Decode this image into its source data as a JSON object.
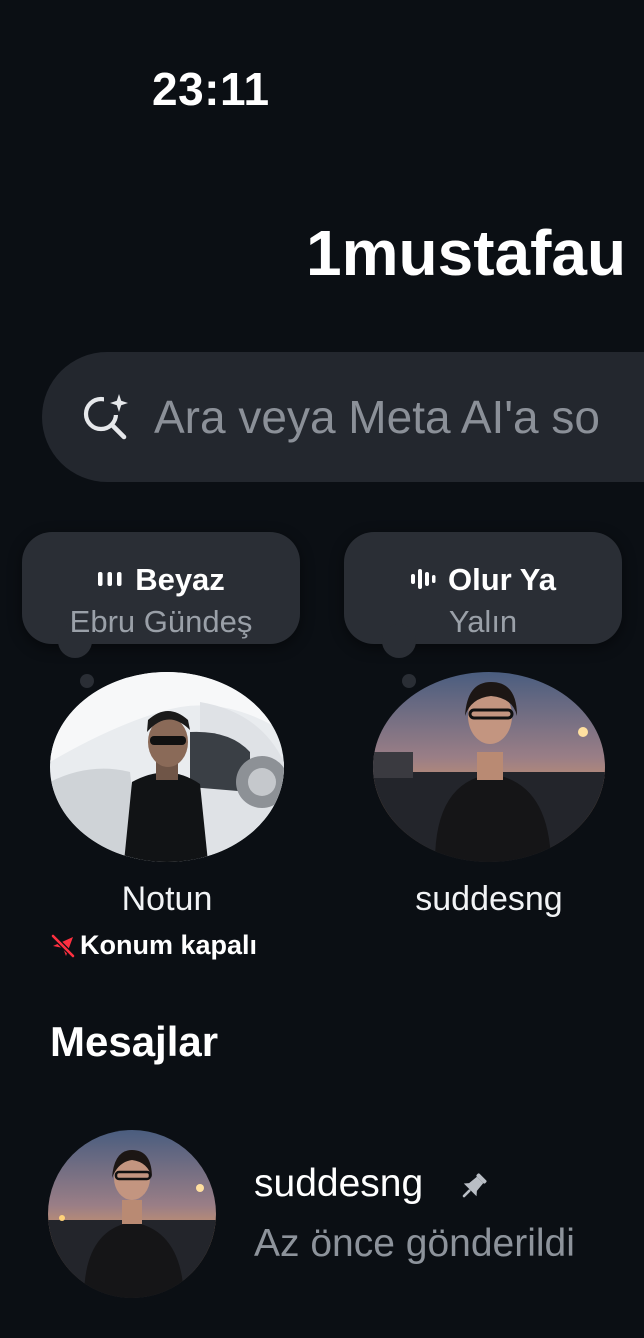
{
  "status_bar": {
    "time": "23:11"
  },
  "header": {
    "username": "1mustafau"
  },
  "search": {
    "placeholder": "Ara veya Meta AI'a so",
    "icon": "meta-ai-search-icon"
  },
  "notes": [
    {
      "song_title": "Beyaz",
      "artist": "Ebru Gündeş",
      "icon": "audio-bars-icon",
      "label": "Notun"
    },
    {
      "song_title": "Olur Ya",
      "artist": "Yalın",
      "icon": "audio-wave-icon",
      "label": "suddesng"
    }
  ],
  "location_status": {
    "text": "Konum kapalı",
    "icon": "location-off-icon",
    "icon_color": "#ff3040"
  },
  "messages": {
    "title": "Mesajlar",
    "items": [
      {
        "name": "suddesng",
        "subtitle": "Az önce gönderildi",
        "icon": "pin-icon"
      }
    ]
  },
  "colors": {
    "background": "#0b0f14",
    "search_bg": "#23272e",
    "note_bg": "#2a2e35",
    "muted_text": "#8d939b"
  }
}
